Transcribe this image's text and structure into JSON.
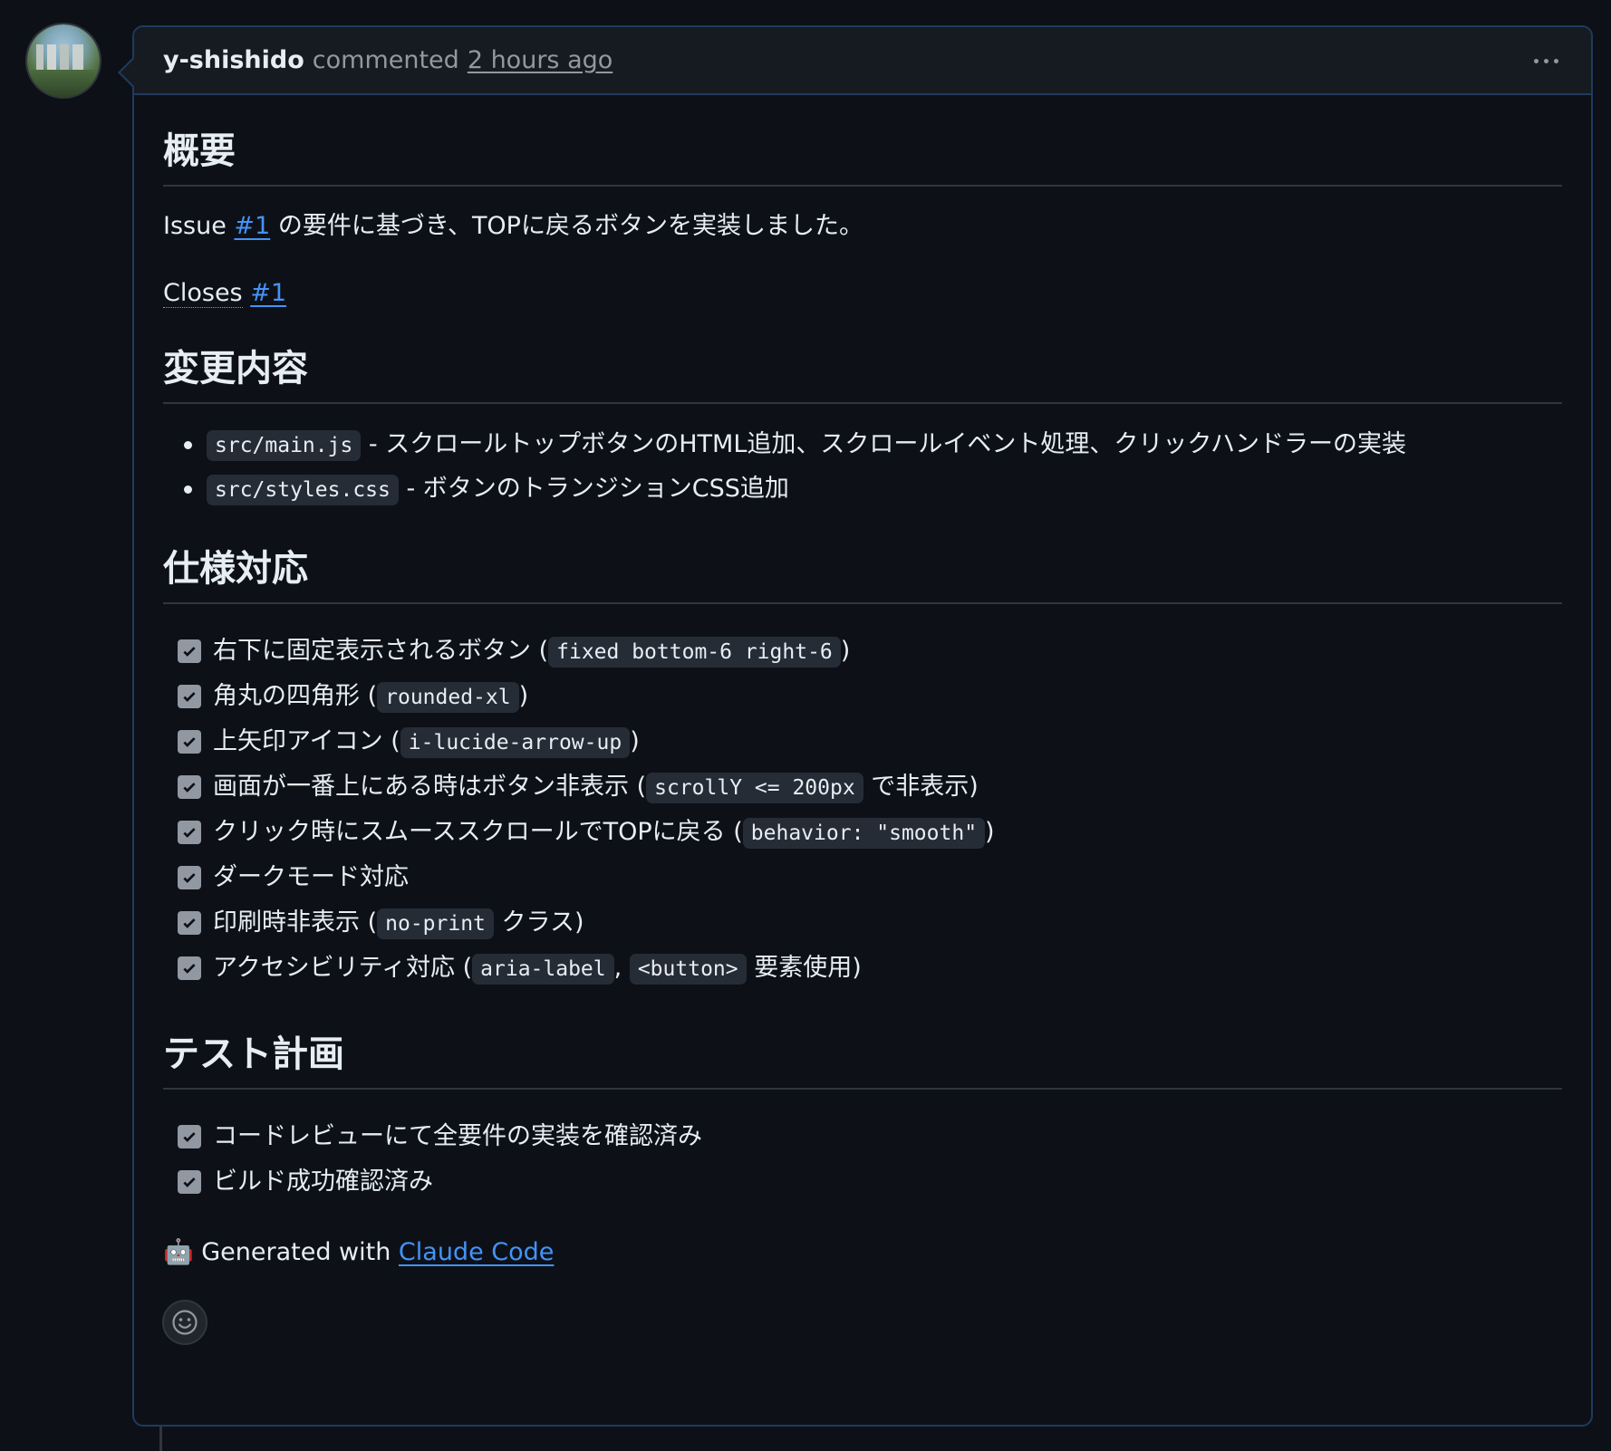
{
  "comment": {
    "author": "y-shishido",
    "action": "commented",
    "time": "2 hours ago"
  },
  "sections": {
    "overview": {
      "heading": "概要",
      "issue_prefix": "Issue",
      "issue_link": "#1",
      "issue_suffix": "の要件に基づき、TOPに戻るボタンを実装しました。",
      "closes_label": "Closes",
      "closes_link": "#1"
    },
    "changes": {
      "heading": "変更内容",
      "items": [
        {
          "code": "src/main.js",
          "text": "- スクロールトップボタンのHTML追加、スクロールイベント処理、クリックハンドラーの実装"
        },
        {
          "code": "src/styles.css",
          "text": "- ボタンのトランジションCSS追加"
        }
      ]
    },
    "spec": {
      "heading": "仕様対応",
      "items": [
        {
          "a": "右下に固定表示されるボタン (",
          "code": "fixed bottom-6 right-6",
          "b": ")"
        },
        {
          "a": "角丸の四角形 (",
          "code": "rounded-xl",
          "b": ")"
        },
        {
          "a": "上矢印アイコン (",
          "code": "i-lucide-arrow-up",
          "b": ")"
        },
        {
          "a": "画面が一番上にある時はボタン非表示 (",
          "code": "scrollY <= 200px",
          "b": "で非表示)"
        },
        {
          "a": "クリック時にスムーススクロールでTOPに戻る (",
          "code": "behavior: \"smooth\"",
          "b": ")"
        },
        {
          "a": "ダークモード対応"
        },
        {
          "a": "印刷時非表示 (",
          "code": "no-print",
          "b": "クラス)"
        },
        {
          "a": "アクセシビリティ対応 (",
          "code": "aria-label",
          "mid": ",",
          "code2": "<button>",
          "b": "要素使用)"
        }
      ]
    },
    "test": {
      "heading": "テスト計画",
      "items": [
        {
          "a": "コードレビューにて全要件の実装を確認済み"
        },
        {
          "a": "ビルド成功確認済み"
        }
      ]
    },
    "footer": {
      "emoji": "🤖",
      "text": "Generated with",
      "link": "Claude Code"
    }
  },
  "icons": {
    "more": "kebab-horizontal-icon",
    "check": "checkmark-icon",
    "reaction": "smiley-icon"
  }
}
